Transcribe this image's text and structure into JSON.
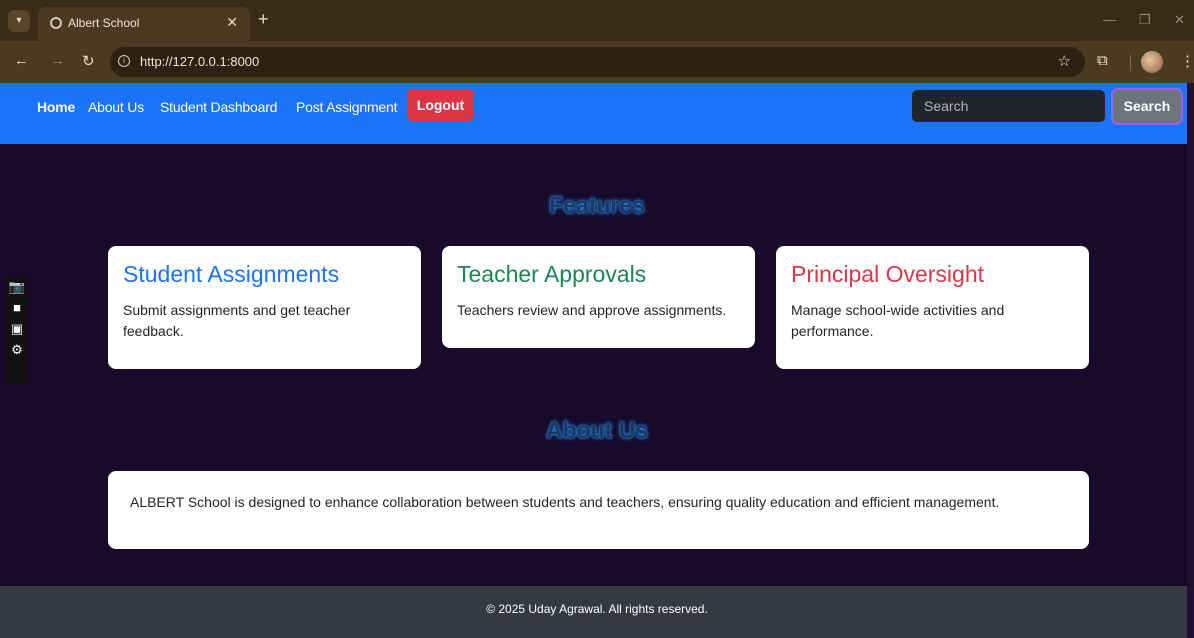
{
  "browser": {
    "tab_title": "Albert School",
    "url": "http://127.0.0.1:8000",
    "icons": {
      "tab_menu": "chevron-down-icon",
      "favicon": "globe-icon",
      "close_tab": "close-icon",
      "new_tab": "plus-icon",
      "back": "arrow-left-icon",
      "forward": "arrow-right-icon",
      "reload": "reload-icon",
      "site_info": "info-icon",
      "bookmark": "star-icon",
      "extensions": "puzzle-icon",
      "profile": "avatar-icon",
      "menu": "kebab-icon"
    }
  },
  "navbar": {
    "links": [
      "Home",
      "About Us",
      "Student Dashboard",
      "Post Assignment"
    ],
    "logout_label": "Logout",
    "search_placeholder": "Search",
    "search_button": "Search",
    "colors": {
      "background": "#1a73f8",
      "logout": "#dc3545",
      "search_button": "#6c757d"
    }
  },
  "features": {
    "heading": "Features",
    "cards": [
      {
        "title": "Student Assignments",
        "text": "Submit assignments and get teacher feedback.",
        "color": "#1a73f8"
      },
      {
        "title": "Teacher Approvals",
        "text": "Teachers review and approve assignments.",
        "color": "#198754"
      },
      {
        "title": "Principal Oversight",
        "text": "Manage school-wide activities and performance.",
        "color": "#dc3545"
      }
    ]
  },
  "about": {
    "heading": "About Us",
    "text": "ALBERT School is designed to enhance collaboration between students and teachers, ensuring quality education and efficient management."
  },
  "side_tools": [
    "camera-icon",
    "video-icon",
    "window-icon",
    "settings-icon"
  ],
  "footer": {
    "text": "© 2025 Uday Agrawal. All rights reserved."
  }
}
